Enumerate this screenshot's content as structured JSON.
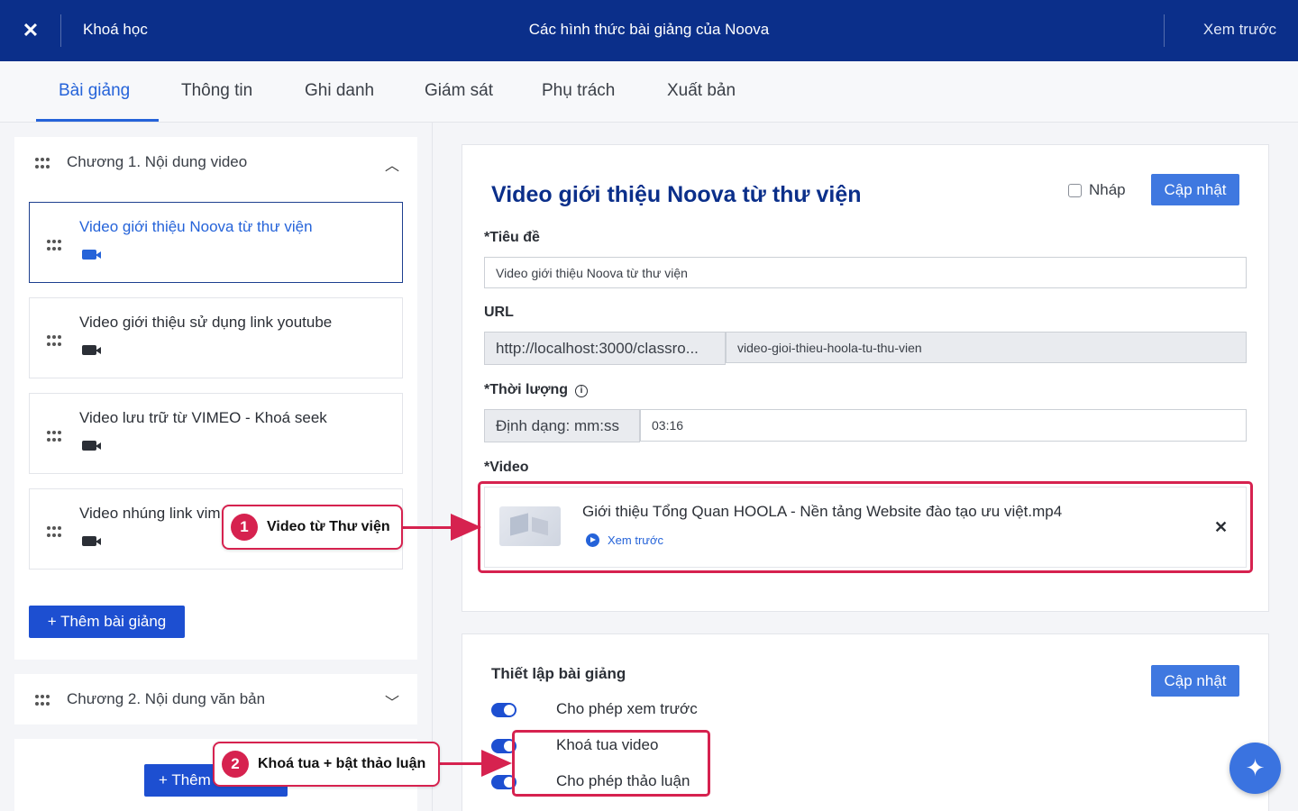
{
  "topbar": {
    "close_icon": "close-icon",
    "course": "Khoá học",
    "title": "Các hình thức bài giảng của Noova",
    "preview": "Xem trước"
  },
  "tabs": [
    {
      "label": "Bài giảng",
      "active": true
    },
    {
      "label": "Thông tin"
    },
    {
      "label": "Ghi danh"
    },
    {
      "label": "Giám sát"
    },
    {
      "label": "Phụ trách"
    },
    {
      "label": "Xuất bản"
    }
  ],
  "chapters": [
    {
      "title": "Chương 1. Nội dung video",
      "expanded": true,
      "lessons": [
        {
          "title": "Video giới thiệu Noova từ thư viện",
          "icon": "video-camera-icon",
          "active": true
        },
        {
          "title": "Video giới thiệu sử dụng link youtube",
          "icon": "video-camera-icon"
        },
        {
          "title": "Video lưu trữ từ VIMEO - Khoá seek",
          "icon": "video-camera-icon"
        },
        {
          "title": "Video nhúng link vim",
          "icon": "video-camera-icon"
        }
      ],
      "add_label": "+ Thêm bài giảng"
    },
    {
      "title": "Chương 2. Nội dung văn bản",
      "expanded": false
    }
  ],
  "add_chapter_label": "+ Thêm",
  "editor": {
    "heading": "Video giới thiệu Noova từ thư viện",
    "draft_label": "Nháp",
    "update_label": "Cập nhật",
    "title_label": "*Tiêu đề",
    "title_value": "Video giới thiệu Noova từ thư viện",
    "url_label": "URL",
    "url_prefix": "http://localhost:3000/classro...",
    "url_slug": "video-gioi-thieu-hoola-tu-thu-vien",
    "duration_label": "*Thời lượng",
    "duration_format": "Định dạng: mm:ss",
    "duration_value": "03:16",
    "video_label": "*Video",
    "video_file": "Giới thiệu Tổng Quan HOOLA - Nền tảng Website đào tạo ưu việt.mp4",
    "video_preview": "Xem trước"
  },
  "settings": {
    "title": "Thiết lập bài giảng",
    "update_label": "Cập nhật",
    "toggles": [
      {
        "label": "Cho phép xem trước",
        "on": true
      },
      {
        "label": "Khoá tua video",
        "on": true
      },
      {
        "label": "Cho phép thảo luận",
        "on": true
      }
    ]
  },
  "annotations": [
    {
      "number": "1",
      "text": "Video từ Thư viện"
    },
    {
      "number": "2",
      "text": "Khoá tua + bật thảo luận"
    }
  ],
  "colors": {
    "topbar": "#0b2f8a",
    "accent": "#2563d9",
    "annotation": "#d6224f"
  }
}
